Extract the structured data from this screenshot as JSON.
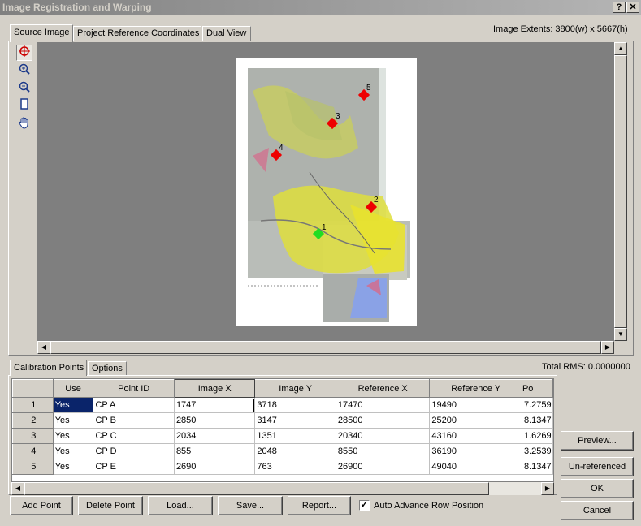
{
  "window": {
    "title": "Image Registration and Warping",
    "help_btn": "?",
    "close_btn": "✕"
  },
  "tabs": [
    {
      "label": "Source Image",
      "active": true
    },
    {
      "label": "Project Reference Coordinates",
      "active": false
    },
    {
      "label": "Dual View",
      "active": false
    }
  ],
  "image_extents": "Image Extents: 3800(w) x 5667(h)",
  "tools": [
    {
      "name": "crosshair-icon",
      "glyph": "⊕"
    },
    {
      "name": "zoom-in-icon",
      "glyph": "⊕"
    },
    {
      "name": "zoom-out-icon",
      "glyph": "⊖"
    },
    {
      "name": "fit-page-icon",
      "glyph": "▯"
    },
    {
      "name": "pan-hand-icon",
      "glyph": "✋"
    }
  ],
  "markers": [
    {
      "label": "1",
      "color": "#22dd22"
    },
    {
      "label": "2",
      "color": "#ee0000"
    },
    {
      "label": "3",
      "color": "#ee0000"
    },
    {
      "label": "4",
      "color": "#ee0000"
    },
    {
      "label": "5",
      "color": "#ee0000"
    }
  ],
  "bottom_tabs": [
    {
      "label": "Calibration Points",
      "active": true
    },
    {
      "label": "Options",
      "active": false
    }
  ],
  "total_rms": "Total RMS: 0.0000000",
  "grid": {
    "columns": [
      "Use",
      "Point ID",
      "Image X",
      "Image Y",
      "Reference X",
      "Reference Y",
      "Po"
    ],
    "rows": [
      {
        "num": "1",
        "use": "Yes",
        "id": "CP A",
        "ix": "1747",
        "iy": "3718",
        "rx": "17470",
        "ry": "19490",
        "po": "7.2759"
      },
      {
        "num": "2",
        "use": "Yes",
        "id": "CP B",
        "ix": "2850",
        "iy": "3147",
        "rx": "28500",
        "ry": "25200",
        "po": "8.1347"
      },
      {
        "num": "3",
        "use": "Yes",
        "id": "CP C",
        "ix": "2034",
        "iy": "1351",
        "rx": "20340",
        "ry": "43160",
        "po": "1.6269"
      },
      {
        "num": "4",
        "use": "Yes",
        "id": "CP D",
        "ix": "855",
        "iy": "2048",
        "rx": "8550",
        "ry": "36190",
        "po": "3.2539"
      },
      {
        "num": "5",
        "use": "Yes",
        "id": "CP E",
        "ix": "2690",
        "iy": "763",
        "rx": "26900",
        "ry": "49040",
        "po": "8.1347"
      }
    ]
  },
  "buttons": {
    "add_point": "Add Point",
    "delete_point": "Delete Point",
    "load": "Load...",
    "save": "Save...",
    "report": "Report...",
    "auto_advance": "Auto Advance Row Position",
    "auto_advance_checked": true,
    "preview": "Preview...",
    "unreferenced": "Un-referenced",
    "ok": "OK",
    "cancel": "Cancel"
  }
}
